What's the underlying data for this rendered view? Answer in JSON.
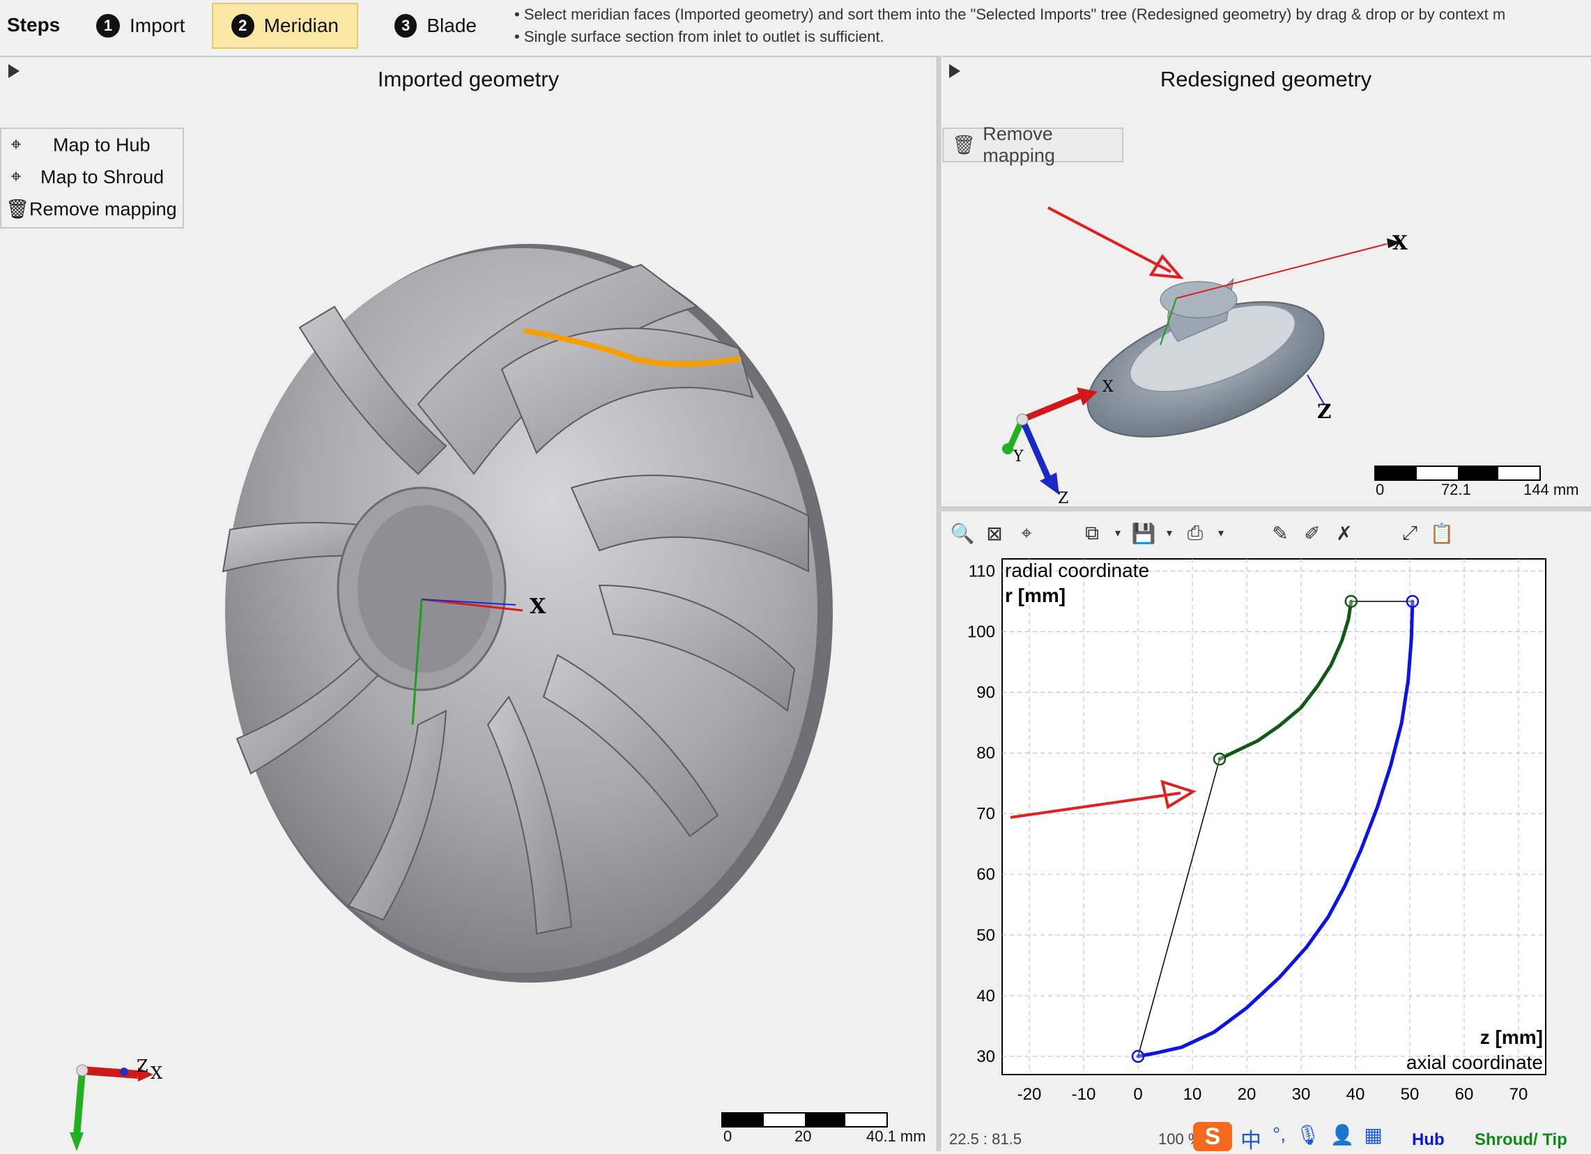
{
  "steps": {
    "label": "Steps",
    "items": [
      {
        "num": "1",
        "label": "Import"
      },
      {
        "num": "2",
        "label": "Meridian"
      },
      {
        "num": "3",
        "label": "Blade"
      }
    ],
    "hint_line1": "• Select meridian faces (Imported geometry) and sort them into the \"Selected Imports\" tree (Redesigned geometry) by drag & drop or by context m",
    "hint_line2": "• Single surface section from inlet to outlet is sufficient."
  },
  "left_panel": {
    "title": "Imported geometry",
    "menu": [
      "Map to Hub",
      "Map to Shroud",
      "Remove mapping"
    ],
    "axis_labels": {
      "x": "X",
      "z": "Z"
    },
    "scale": {
      "ticks": [
        "0",
        "20",
        "40.1 mm"
      ]
    }
  },
  "right_top": {
    "title": "Redesigned geometry",
    "remove_label": "Remove mapping",
    "axis_labels": {
      "x": "X",
      "y": "Y",
      "z": "Z"
    },
    "scale": {
      "ticks": [
        "0",
        "72.1",
        "144 mm"
      ]
    }
  },
  "chart_data": {
    "type": "line",
    "title": "",
    "ylabel_line1": "radial coordinate",
    "ylabel_line2": "r [mm]",
    "xlabel_line1": "z [mm]",
    "xlabel_line2": "axial coordinate",
    "xlim": [
      -25,
      75
    ],
    "ylim": [
      27,
      112
    ],
    "x_ticks": [
      -20,
      -10,
      0,
      10,
      20,
      30,
      40,
      50,
      60,
      70
    ],
    "y_ticks": [
      30,
      40,
      50,
      60,
      70,
      80,
      90,
      100,
      110
    ],
    "grid": true,
    "series": [
      {
        "name": "Hub",
        "color": "#0a14e6",
        "x": [
          0,
          3,
          8,
          14,
          20,
          26,
          31,
          35,
          38,
          41,
          44,
          46.5,
          48.5,
          49.7,
          50.3,
          50.5
        ],
        "y": [
          30,
          30.5,
          31.5,
          34,
          38,
          43,
          48,
          53,
          58,
          64,
          71,
          78,
          85,
          92,
          99,
          105
        ]
      },
      {
        "name": "Shroud/ Tip",
        "color": "#0f5a14",
        "x": [
          15,
          18,
          22,
          26,
          30,
          33,
          35.5,
          37.5,
          38.7,
          39.2
        ],
        "y": [
          79,
          80.3,
          82,
          84.5,
          87.5,
          91,
          94.5,
          98.5,
          102,
          105
        ]
      },
      {
        "name": "inlet",
        "color": "#000000",
        "x": [
          0,
          15
        ],
        "y": [
          30,
          79
        ]
      },
      {
        "name": "outlet",
        "color": "#000000",
        "x": [
          39.2,
          50.5
        ],
        "y": [
          105,
          105
        ]
      }
    ]
  },
  "status": {
    "coords": "22.5 : 81.5",
    "zoom": "100 %",
    "ime_char": "中",
    "legend_hub": "Hub",
    "legend_shroud": "Shroud/ Tip"
  },
  "colors": {
    "active_step": "#fbe7a6",
    "hub": "#0a14e6",
    "shroud": "#0f5a14",
    "arrow": "#e0201e"
  }
}
